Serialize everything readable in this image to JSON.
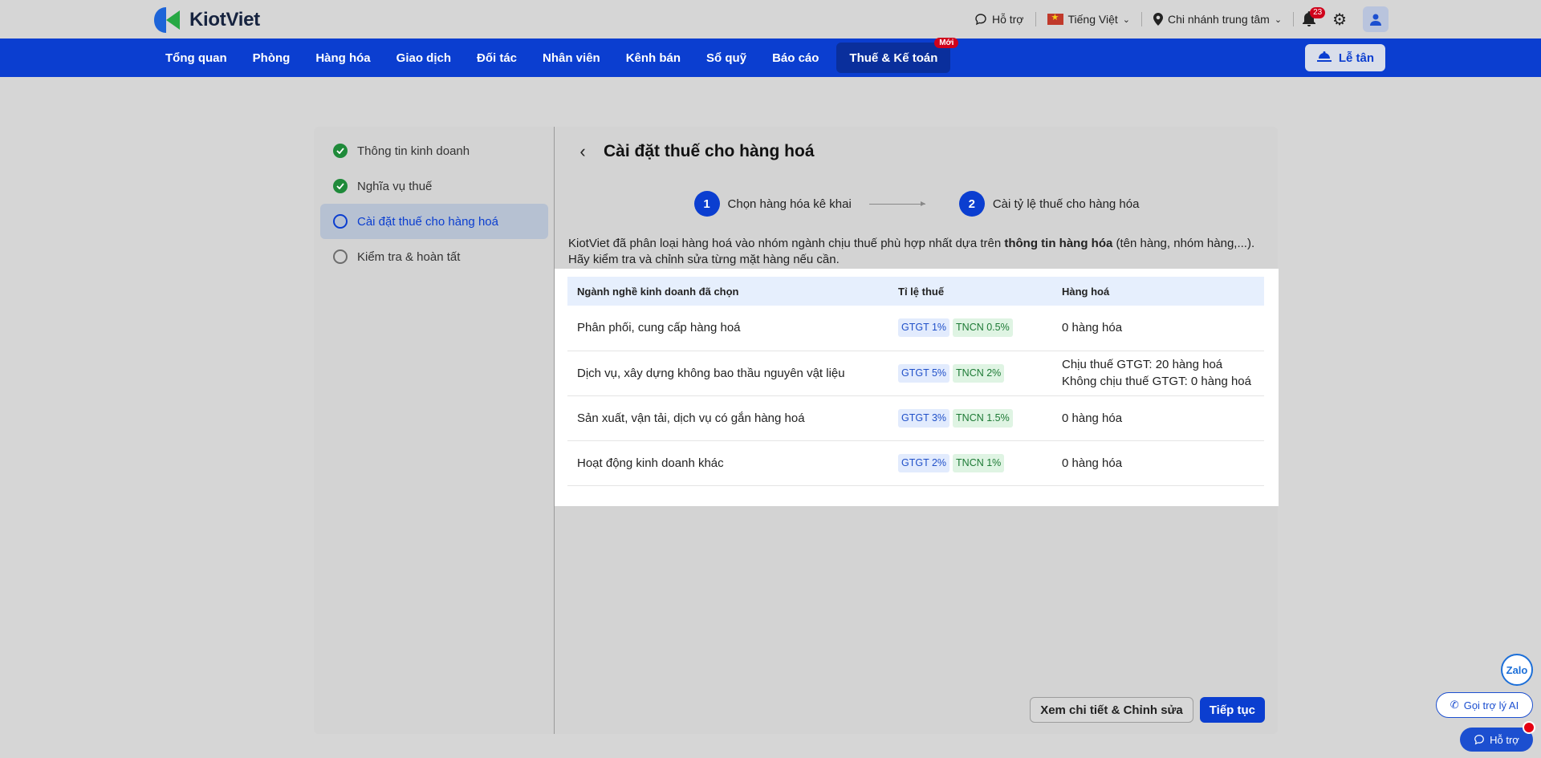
{
  "topbar": {
    "logo_text": "KiotViet",
    "support": "Hỗ trợ",
    "language": "Tiếng Việt",
    "branch": "Chi nhánh trung tâm",
    "notification_count": "23"
  },
  "nav": {
    "items": [
      "Tổng quan",
      "Phòng",
      "Hàng hóa",
      "Giao dịch",
      "Đối tác",
      "Nhân viên",
      "Kênh bán",
      "Sổ quỹ",
      "Báo cáo"
    ],
    "active_item": "Thuế & Kế toán",
    "new_badge": "Mới",
    "reception_button": "Lễ tân"
  },
  "sidebar": {
    "steps": [
      {
        "label": "Thông tin kinh doanh",
        "state": "done"
      },
      {
        "label": "Nghĩa vụ thuế",
        "state": "done"
      },
      {
        "label": "Cài đặt thuế cho hàng hoá",
        "state": "current"
      },
      {
        "label": "Kiểm tra & hoàn tất",
        "state": "pending"
      }
    ]
  },
  "main": {
    "title": "Cài đặt thuế cho hàng hoá",
    "wizard": [
      {
        "num": "1",
        "label": "Chọn hàng hóa kê khai"
      },
      {
        "num": "2",
        "label": "Cài tỷ lệ thuế cho hàng hóa"
      }
    ],
    "description_pre": "KiotViet đã phân loại hàng hoá vào nhóm ngành chịu thuế phù hợp nhất dựa trên ",
    "description_bold": "thông tin hàng hóa",
    "description_post": " (tên hàng, nhóm hàng,...). Hãy kiểm tra và chỉnh sửa từng mặt hàng nếu cần.",
    "table": {
      "headers": [
        "Ngành nghề kinh doanh đã chọn",
        "Tỉ lệ thuế",
        "Hàng hoá"
      ],
      "rows": [
        {
          "industry": "Phân phối, cung cấp hàng hoá",
          "gtgt": "GTGT 1%",
          "tncn": "TNCN 0.5%",
          "goods_line1": "0 hàng hóa",
          "goods_line2": ""
        },
        {
          "industry": "Dịch vụ, xây dựng không bao thầu nguyên vật liệu",
          "gtgt": "GTGT 5%",
          "tncn": "TNCN 2%",
          "goods_line1": "Chịu thuế GTGT: 20 hàng hoá",
          "goods_line2": "Không chịu thuế GTGT: 0 hàng hoá"
        },
        {
          "industry": "Sản xuất, vận tải, dịch vụ có gắn hàng hoá",
          "gtgt": "GTGT 3%",
          "tncn": "TNCN 1.5%",
          "goods_line1": "0 hàng hóa",
          "goods_line2": ""
        },
        {
          "industry": "Hoạt động kinh doanh khác",
          "gtgt": "GTGT 2%",
          "tncn": "TNCN 1%",
          "goods_line1": "0 hàng hóa",
          "goods_line2": ""
        }
      ]
    },
    "buttons": {
      "detail": "Xem chi tiết & Chỉnh sửa",
      "continue": "Tiếp tục"
    }
  },
  "floating": {
    "zalo": "Zalo",
    "ai_assistant": "Gọi trợ lý AI",
    "help": "Hỗ trợ"
  },
  "colors": {
    "brand_blue": "#0b3ed0",
    "success_green": "#1f8a3a",
    "alert_red": "#d0021b"
  }
}
